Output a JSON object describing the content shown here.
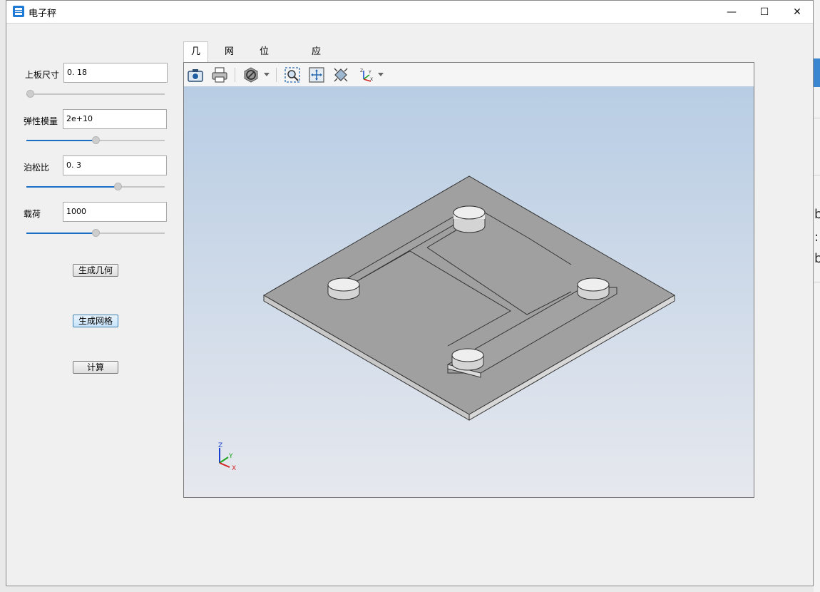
{
  "window": {
    "title": "电子秤",
    "controls": {
      "minimize": "—",
      "maximize": "☐",
      "close": "✕"
    }
  },
  "params": [
    {
      "label": "上板尺寸",
      "value": "0. 18",
      "slider": 0.0
    },
    {
      "label": "弹性模量",
      "value": "2e+10",
      "slider": 0.5
    },
    {
      "label": "泊松比",
      "value": "0. 3",
      "slider": 0.67
    },
    {
      "label": "载荷",
      "value": "1000",
      "slider": 0.5
    }
  ],
  "buttons": {
    "generate_geometry": "生成几何",
    "generate_mesh": "生成网格",
    "compute": "计算"
  },
  "tabs": [
    "几何",
    "网络",
    "位移云图",
    "应力云图"
  ],
  "active_tab": 0,
  "toolbar_icons": [
    "camera-icon",
    "print-icon",
    "display-mode-icon",
    "zoom-box-icon",
    "fit-all-icon",
    "reset-view-icon",
    "axis-orientation-icon"
  ],
  "axis_triad": {
    "x": "X",
    "y": "Y",
    "z": "Z"
  },
  "background_text": [
    "b",
    ":",
    "b"
  ],
  "colors": {
    "accent": "#1a6fc4",
    "viewport_top": "#b8cde4",
    "viewport_bottom": "#e6e8ee",
    "model": "#a0a0a0"
  }
}
